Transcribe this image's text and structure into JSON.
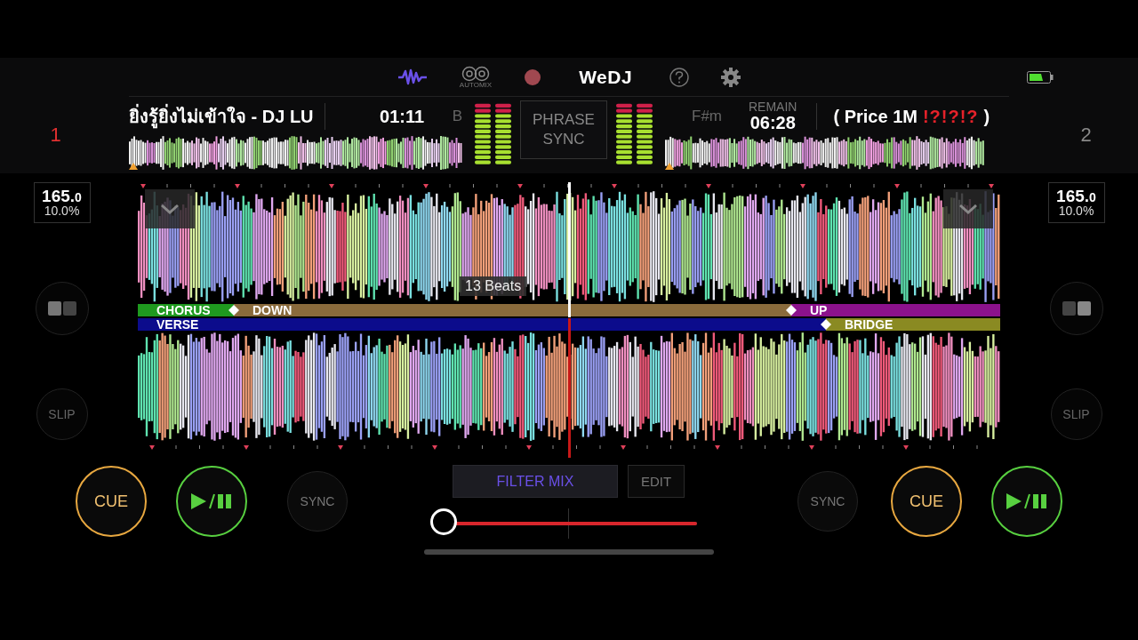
{
  "topbar": {
    "waveform_view": {
      "selected": true
    },
    "automix": {
      "label": "AUTOMIX"
    },
    "record": {
      "on": false
    },
    "logo": "WeDJ"
  },
  "decks": [
    {
      "number": "1",
      "master": true,
      "title_parts": [
        {
          "text": "ยิ่งรู้ยิ่งไม่เข้าใจ - DJ LU",
          "kind": "plain"
        }
      ],
      "time": "01:11",
      "key": "B",
      "bpm": "165.",
      "bpm_decimal": "0",
      "pitch": "10.0%",
      "beats_label": "13 Beats",
      "slip": "SLIP",
      "cue": "CUE",
      "sync": "SYNC",
      "phrases": [
        {
          "label": "CHORUS",
          "color": "#1f9a1f"
        },
        {
          "label": "DOWN",
          "color": "#8a6b3c"
        },
        {
          "label": "UP",
          "color": "#8c128c"
        }
      ]
    },
    {
      "number": "2",
      "master": false,
      "title_parts": [
        {
          "text": "( Price 1M",
          "kind": "plain"
        },
        {
          "text": "!?!?!?",
          "kind": "alert"
        },
        {
          "text": ")",
          "kind": "plain"
        }
      ],
      "time_label": "REMAIN",
      "time": "06:28",
      "key": "F#m",
      "bpm": "165.",
      "bpm_decimal": "0",
      "pitch": "10.0%",
      "slip": "SLIP",
      "cue": "CUE",
      "sync": "SYNC",
      "phrases": [
        {
          "label": "VERSE",
          "color": "#0c0c8c"
        },
        {
          "label": "BRIDGE",
          "color": "#8a8a22"
        }
      ]
    }
  ],
  "center": {
    "phrase_sync": "PHRASE SYNC"
  },
  "mixer": {
    "filter_mix": {
      "label": "FILTER MIX",
      "selected": true
    },
    "edit": "EDIT",
    "crossfader": {
      "level": 0
    }
  }
}
